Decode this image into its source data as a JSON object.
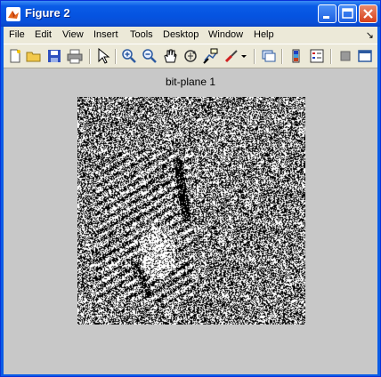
{
  "window": {
    "title": "Figure 2"
  },
  "menu": [
    "File",
    "Edit",
    "View",
    "Insert",
    "Tools",
    "Desktop",
    "Window",
    "Help"
  ],
  "menu_overflow": "↘",
  "toolbar": {
    "icons": [
      "new-figure-icon",
      "open-file-icon",
      "save-icon",
      "print-icon",
      "edit-plot-icon",
      "zoom-in-icon",
      "zoom-out-icon",
      "pan-icon",
      "rotate-3d-icon",
      "data-cursor-icon",
      "brush-icon",
      "colorbar-icon",
      "legend-icon",
      "hide-plot-tools-icon",
      "show-plot-tools-icon"
    ]
  },
  "axes": {
    "title": "bit-plane 1"
  },
  "colors": {
    "titlebar": "#0a5ce6",
    "figure_bg": "#c8c8c8",
    "close": "#d6401c"
  }
}
